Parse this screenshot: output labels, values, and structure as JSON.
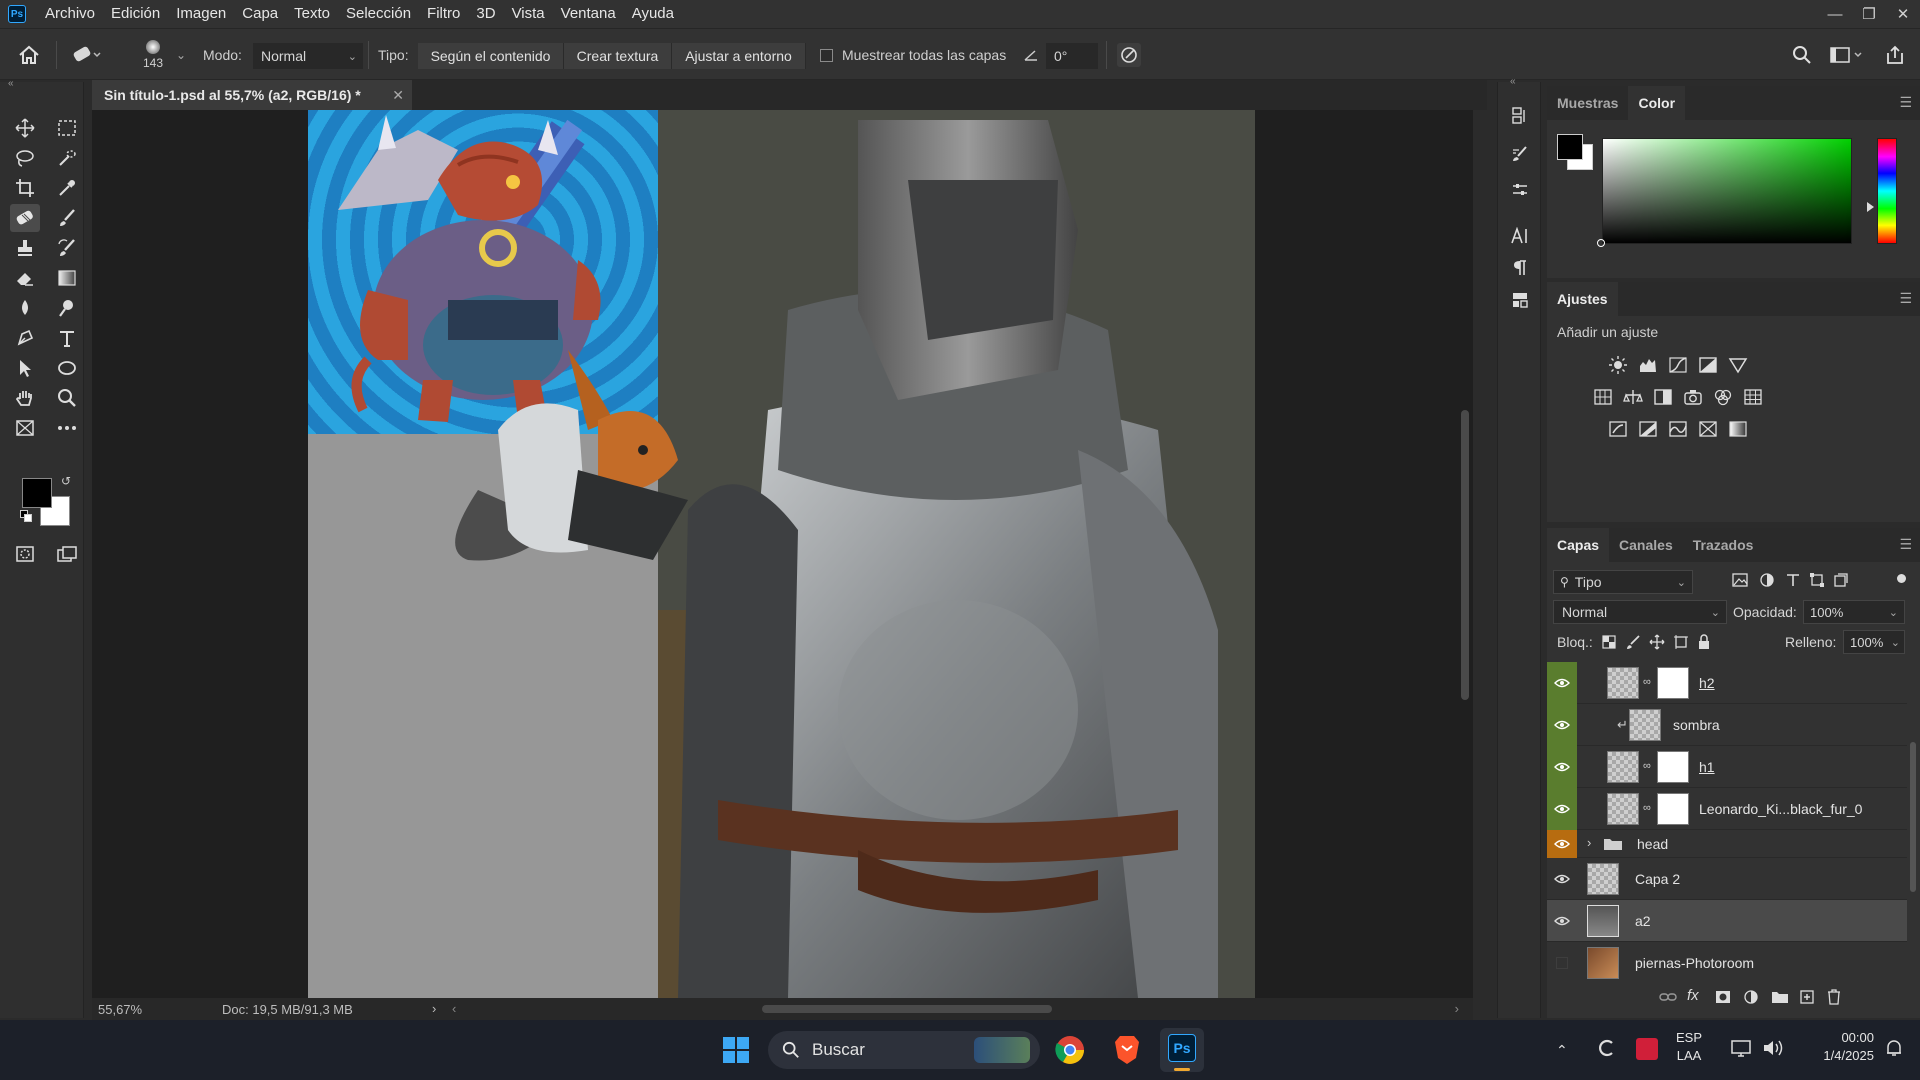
{
  "app": {
    "logo_text": "Ps"
  },
  "menu": [
    "Archivo",
    "Edición",
    "Imagen",
    "Capa",
    "Texto",
    "Selección",
    "Filtro",
    "3D",
    "Vista",
    "Ventana",
    "Ayuda"
  ],
  "options": {
    "brush_size": "143",
    "mode_label": "Modo:",
    "mode_value": "Normal",
    "type_label": "Tipo:",
    "type_buttons": [
      "Según el contenido",
      "Crear textura",
      "Ajustar a entorno"
    ],
    "sample_all_layers_label": "Muestrear todas las capas",
    "sample_all_layers_checked": false,
    "angle_value": "0°"
  },
  "document": {
    "tab_title": "Sin título-1.psd al 55,7% (a2, RGB/16) *",
    "zoom": "55,67%",
    "doc_size": "Doc: 19,5 MB/91,3 MB"
  },
  "panels": {
    "color": {
      "tabs": [
        "Muestras",
        "Color"
      ],
      "active_tab": "Color",
      "foreground": "#000000",
      "background": "#ffffff"
    },
    "adjustments": {
      "title": "Ajustes",
      "subtitle": "Añadir un ajuste"
    },
    "layers": {
      "tabs": [
        "Capas",
        "Canales",
        "Trazados"
      ],
      "active_tab": "Capas",
      "filter_label": "Tipo",
      "blend_mode": "Normal",
      "opacity_label": "Opacidad:",
      "opacity_value": "100%",
      "lock_label": "Bloq.:",
      "fill_label": "Relleno:",
      "fill_value": "100%",
      "items": [
        {
          "name": "h2",
          "visible": true,
          "color_tag": "green"
        },
        {
          "name": "sombra",
          "visible": true,
          "color_tag": "green"
        },
        {
          "name": "h1",
          "visible": true,
          "color_tag": "green"
        },
        {
          "name": "Leonardo_Ki...black_fur_0",
          "visible": true,
          "color_tag": "green"
        },
        {
          "name": "head",
          "visible": true,
          "color_tag": "orange"
        },
        {
          "name": "Capa 2",
          "visible": true,
          "color_tag": "none"
        },
        {
          "name": "a2",
          "visible": true,
          "color_tag": "none",
          "selected": true
        },
        {
          "name": "piernas-Photoroom",
          "visible": false,
          "color_tag": "none"
        }
      ]
    }
  },
  "taskbar": {
    "search_placeholder": "Buscar",
    "language": "ESP",
    "keyboard": "LAA",
    "time": "00:00",
    "date": "1/4/2025"
  },
  "colors": {
    "accent_blue": "#31a8ff",
    "tag_green": "#5a7d2e",
    "tag_orange": "#b76c10"
  }
}
